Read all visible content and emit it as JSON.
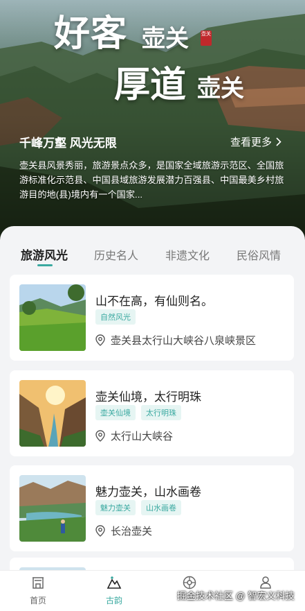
{
  "hero": {
    "calligraphy_line1": "好客",
    "calligraphy_line1_small": "壶关",
    "calligraphy_line2": "厚道",
    "calligraphy_line2_small": "壶关",
    "seal_text": "壶关",
    "slogan": "千峰万壑 风光无限",
    "more_label": "查看更多",
    "description": "壶关县风景秀丽，旅游景点众多，是国家全域旅游示范区、全国旅游标准化示范县、中国县域旅游发展潜力百强县、中国最美乡村旅游目的地(县)境内有一个国家..."
  },
  "tabs": [
    {
      "label": "旅游风光",
      "active": true
    },
    {
      "label": "历史名人",
      "active": false
    },
    {
      "label": "非遗文化",
      "active": false
    },
    {
      "label": "民俗风情",
      "active": false
    }
  ],
  "cards": [
    {
      "title": "山不在高，有仙则名。",
      "tags": [
        "自然风光"
      ],
      "location": "壶关县太行山大峡谷八泉峡景区"
    },
    {
      "title": "壶关仙境，太行明珠",
      "tags": [
        "壶关仙境",
        "太行明珠"
      ],
      "location": "太行山大峡谷"
    },
    {
      "title": "魅力壶关，山水画卷",
      "tags": [
        "魅力壶关",
        "山水画卷"
      ],
      "location": "长治壶关"
    }
  ],
  "nav": [
    {
      "label": "首页",
      "icon": "home-icon",
      "active": false
    },
    {
      "label": "古韵",
      "icon": "mountain-icon",
      "active": true
    },
    {
      "label": "",
      "icon": "compass-icon",
      "active": false
    },
    {
      "label": "",
      "icon": "user-icon",
      "active": false
    }
  ],
  "watermark": "掘金技术社区 @ 智宏义科技",
  "colors": {
    "accent": "#3aa9a0",
    "tag_bg": "#e6f5f3",
    "seal": "#c0282b"
  }
}
